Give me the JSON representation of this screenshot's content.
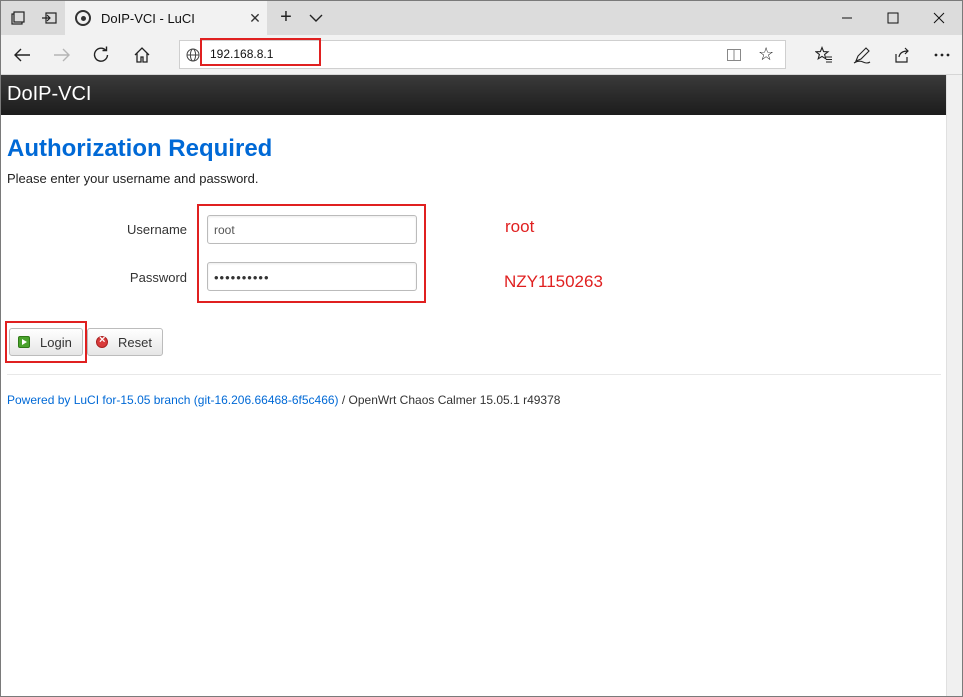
{
  "browser": {
    "tab_title": "DoIP-VCI - LuCI",
    "address": "192.168.8.1"
  },
  "icons": {
    "tab_actions": "tab-preview-icon",
    "set_aside": "set-aside-tabs-icon",
    "back": "back-arrow-icon",
    "forward": "forward-arrow-icon",
    "refresh": "refresh-icon",
    "home": "home-icon",
    "favorite": "star-icon",
    "favorites_hub": "favorites-list-icon",
    "notes": "pen-icon",
    "share": "share-icon",
    "more": "more-icon"
  },
  "page": {
    "header_title": "DoIP-VCI",
    "auth_title": "Authorization Required",
    "auth_desc": "Please enter your username and password.",
    "username_label": "Username",
    "username_value": "root",
    "password_label": "Password",
    "password_value": "••••••••••",
    "login_label": "Login",
    "reset_label": "Reset",
    "footer_link": "Powered by LuCI for-15.05 branch (git-16.206.66468-6f5c466)",
    "footer_text": " / OpenWrt Chaos Calmer 15.05.1 r49378"
  },
  "annotations": {
    "username_hint": "root",
    "password_hint": "NZY1150263"
  },
  "colors": {
    "accent_blue": "#0069d6",
    "annotation_red": "#e02020",
    "header_dark": "#222222"
  }
}
